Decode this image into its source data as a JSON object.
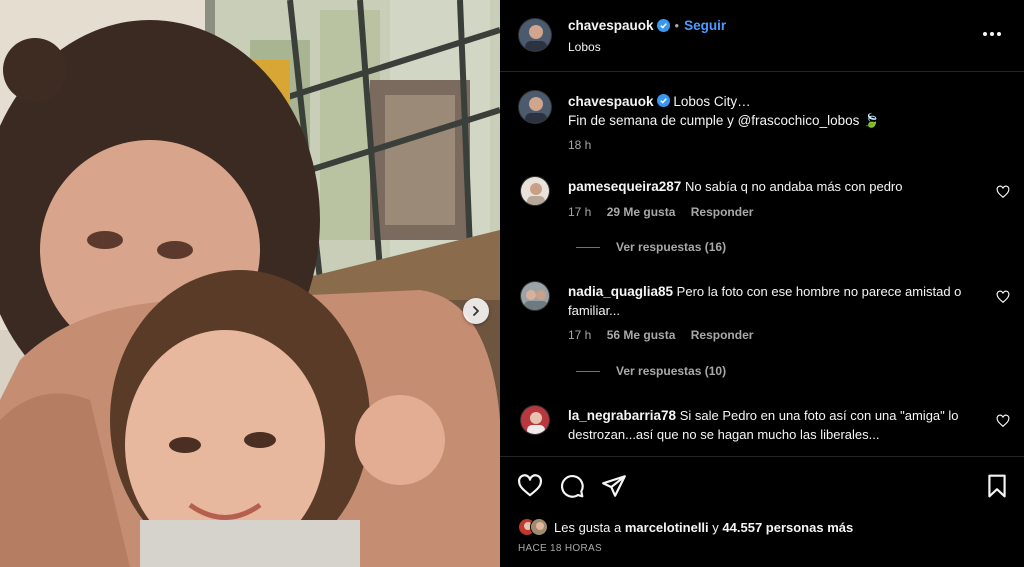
{
  "header": {
    "username": "chavespauok",
    "follow_label": "Seguir",
    "location": "Lobos"
  },
  "caption": {
    "username": "chavespauok",
    "line1": "Lobos City…",
    "line2": "Fin de semana de cumple y @frascochico_lobos",
    "emoji": "🍃",
    "time": "18 h"
  },
  "comments": [
    {
      "username": "pamesequeira287",
      "text": "No sabía q no andaba más con pedro",
      "time": "17 h",
      "likes": "29 Me gusta",
      "reply": "Responder",
      "replies": "Ver respuestas (16)"
    },
    {
      "username": "nadia_quaglia85",
      "text": "Pero la foto con ese hombre no parece amistad o familiar...",
      "time": "17 h",
      "likes": "56 Me gusta",
      "reply": "Responder",
      "replies": "Ver respuestas (10)"
    },
    {
      "username": "la_negrabarria78",
      "text": "Si sale Pedro en una foto así con una \"amiga\" lo destrozan...así que no se hagan mucho las liberales..."
    }
  ],
  "footer": {
    "likes_prefix": "Les gusta a",
    "likes_user": "marcelotinelli",
    "likes_connector": "y",
    "likes_count": "44.557 personas más",
    "time_ago": "HACE 18 HORAS"
  },
  "colors": {
    "background": "#000000",
    "link": "#4a9dff",
    "verified": "#3897f0",
    "muted": "#a8a8a8"
  },
  "icons": [
    "heart-icon",
    "comment-icon",
    "share-icon",
    "bookmark-icon",
    "more-icon",
    "verified-icon",
    "chevron-right-icon"
  ]
}
